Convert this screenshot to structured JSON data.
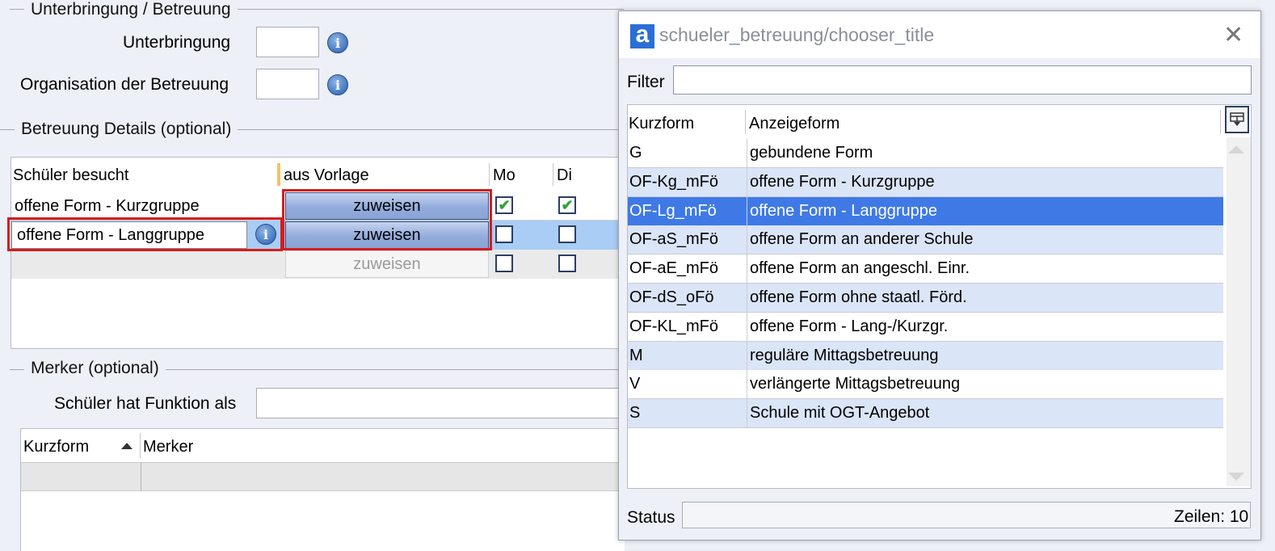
{
  "unterbringung_group": {
    "title": "Unterbringung / Betreuung",
    "unterbringung_label": "Unterbringung",
    "organisation_label": "Organisation der Betreuung",
    "info_icon": "i"
  },
  "details_group": {
    "title": "Betreuung Details (optional)",
    "columns": [
      "Schüler besucht",
      "aus Vorlage",
      "Mo",
      "Di"
    ],
    "rows": [
      {
        "besucht": "offene Form - Kurzgruppe",
        "button": "zuweisen",
        "mo": true,
        "di": true
      },
      {
        "besucht": "offene Form - Langgruppe",
        "button": "zuweisen",
        "mo": false,
        "di": false
      },
      {
        "besucht": "",
        "button": "zuweisen",
        "mo": false,
        "di": false
      }
    ]
  },
  "merker_group": {
    "title": "Merker (optional)",
    "funktion_label": "Schüler hat Funktion als",
    "columns": [
      "Kurzform",
      "Merker"
    ]
  },
  "chooser": {
    "title": "schueler_betreuung/chooser_title",
    "app_icon": "a",
    "close": "✕",
    "filter_label": "Filter",
    "filter_value": "",
    "columns": [
      "Kurzform",
      "Anzeigeform"
    ],
    "rows": [
      {
        "kurz": "G",
        "anzeige": "gebundene Form"
      },
      {
        "kurz": "OF-Kg_mFö",
        "anzeige": "offene Form - Kurzgruppe"
      },
      {
        "kurz": "OF-Lg_mFö",
        "anzeige": "offene Form - Langgruppe"
      },
      {
        "kurz": "OF-aS_mFö",
        "anzeige": "offene Form an anderer Schule"
      },
      {
        "kurz": "OF-aE_mFö",
        "anzeige": "offene Form an angeschl. Einr."
      },
      {
        "kurz": "OF-dS_oFö",
        "anzeige": "offene Form ohne staatl. Förd."
      },
      {
        "kurz": "OF-KL_mFö",
        "anzeige": "offene Form - Lang-/Kurzgr."
      },
      {
        "kurz": "M",
        "anzeige": "reguläre Mittagsbetreuung"
      },
      {
        "kurz": "V",
        "anzeige": "verlängerte Mittagsbetreuung"
      },
      {
        "kurz": "S",
        "anzeige": "Schule mit OGT-Angebot"
      }
    ],
    "selected_index": 2,
    "status_label": "Status",
    "zeilen_text": "Zeilen: 10"
  },
  "colors": {
    "selected_row": "#3f79e6",
    "alt_row": "#dbe5f8",
    "highlight_border": "#d51d1d",
    "button_blue": "#93acdc"
  }
}
